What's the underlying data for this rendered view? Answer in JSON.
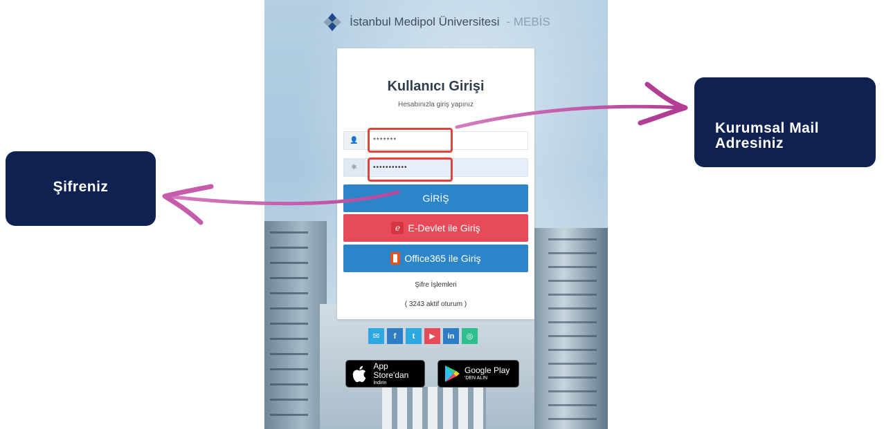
{
  "header": {
    "title": "İstanbul Medipol Üniversitesi",
    "suffix": "- MEBİS"
  },
  "login": {
    "title": "Kullanıcı Girişi",
    "subtitle": "Hesabınızla giriş yapınız",
    "username_value": "*******",
    "password_value": "•••••••••••",
    "login_button": "GİRİŞ",
    "edevlet_button": "E-Devlet ile Giriş",
    "office_button": "Office365 ile Giriş",
    "password_ops_link": "Şifre İşlemleri",
    "active_sessions": "( 3243 aktif oturum )"
  },
  "social": [
    {
      "name": "mail",
      "glyph": "✉",
      "color": "#2ea8e0"
    },
    {
      "name": "facebook",
      "glyph": "f",
      "color": "#2f7cc6"
    },
    {
      "name": "twitter",
      "glyph": "🐦",
      "color": "#2ea8e0"
    },
    {
      "name": "youtube",
      "glyph": "▶",
      "color": "#e74b5a"
    },
    {
      "name": "linkedin",
      "glyph": "in",
      "color": "#2f7cc6"
    },
    {
      "name": "instagram",
      "glyph": "◎",
      "color": "#2fbf8f"
    }
  ],
  "stores": {
    "apple_main": "App Store'dan",
    "apple_sub": "İndirin",
    "google_main": "Google Play",
    "google_sub": "'DEN ALIN"
  },
  "callouts": {
    "mail_line1": "Kurumsal Mail",
    "mail_line2": "Adresiniz",
    "password": "Şifreniz"
  },
  "colors": {
    "callout_bg": "#0e2151",
    "highlight": "#e0443c",
    "arrow": "#c2489c",
    "primary_button": "#2d85c9",
    "edevlet_button": "#e74b5a"
  }
}
